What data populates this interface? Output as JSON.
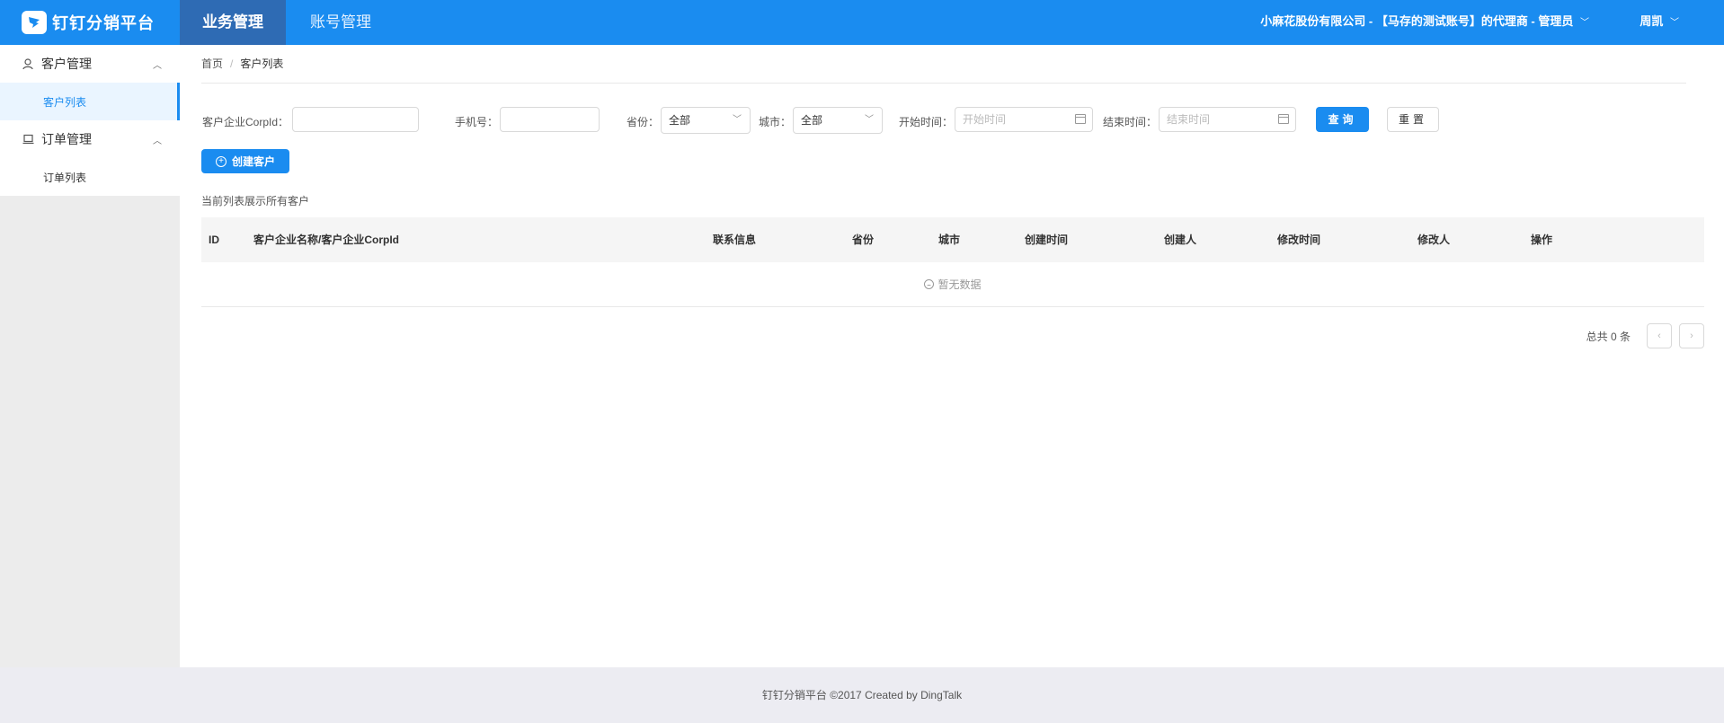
{
  "header": {
    "app_title": "钉钉分销平台",
    "tabs": [
      {
        "label": "业务管理",
        "active": true
      },
      {
        "label": "账号管理",
        "active": false
      }
    ],
    "org_info": "小麻花股份有限公司 - 【马存的测试账号】的代理商 - 管理员",
    "user_name": "周凯"
  },
  "sidebar": {
    "groups": [
      {
        "label": "客户管理",
        "icon": "user-icon",
        "expanded": true,
        "items": [
          {
            "label": "客户列表",
            "active": true
          }
        ]
      },
      {
        "label": "订单管理",
        "icon": "laptop-icon",
        "expanded": true,
        "items": [
          {
            "label": "订单列表",
            "active": false
          }
        ]
      }
    ]
  },
  "breadcrumb": {
    "home": "首页",
    "separator": "/",
    "current": "客户列表"
  },
  "filters": {
    "corp_id_label": "客户企业CorpId：",
    "corp_id_value": "",
    "phone_label": "手机号：",
    "phone_value": "",
    "province_label": "省份：",
    "province_value": "全部",
    "city_label": "城市：",
    "city_value": "全部",
    "start_label": "开始时间：",
    "start_placeholder": "开始时间",
    "end_label": "结束时间：",
    "end_placeholder": "结束时间",
    "query_button": "查询",
    "reset_button": "重置"
  },
  "actions": {
    "create_button": "创建客户"
  },
  "list_note": "当前列表展示所有客户",
  "table": {
    "columns": [
      "ID",
      "客户企业名称/客户企业CorpId",
      "联系信息",
      "省份",
      "城市",
      "创建时间",
      "创建人",
      "修改时间",
      "修改人",
      "操作"
    ],
    "rows": [],
    "empty_text": "暂无数据"
  },
  "pagination": {
    "total_text": "总共 0 条",
    "prev": "‹",
    "next": "›"
  },
  "footer": {
    "text": "钉钉分销平台 ©2017 Created by DingTalk"
  },
  "colors": {
    "primary": "#1a8cf0",
    "active_tab": "#2e6bb4"
  }
}
